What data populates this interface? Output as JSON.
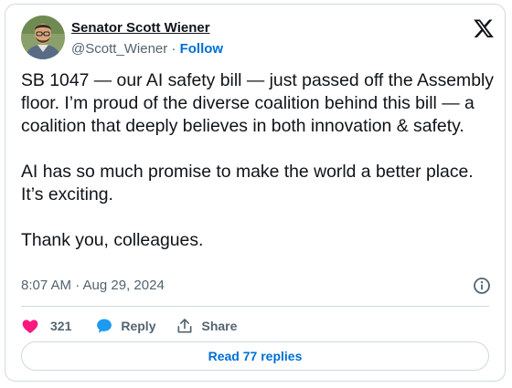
{
  "author": {
    "name": "Senator Scott Wiener",
    "handle": "@Scott_Wiener",
    "separator": "·",
    "follow_label": "Follow"
  },
  "tweet": {
    "text": "SB 1047 — our AI safety bill — just passed off the Assembly floor. I’m proud of the diverse coalition behind this bill — a coalition that deeply believes in both innovation & safety.\n\nAI has so much promise to make the world a better place. It’s exciting.\n\nThank you, colleagues.",
    "timestamp": "8:07 AM · Aug 29, 2024"
  },
  "actions": {
    "like_count": "321",
    "reply_label": "Reply",
    "share_label": "Share"
  },
  "read_replies_label": "Read 77 replies",
  "icons": {
    "logo": "x-logo-icon",
    "info": "info-icon",
    "like": "heart-icon",
    "reply": "speech-bubble-icon",
    "share": "share-upload-icon"
  },
  "colors": {
    "like": "#f91880",
    "reply": "#1d9bf0",
    "link": "#006fd6",
    "secondary_text": "#536471",
    "border": "#cfd9de"
  }
}
